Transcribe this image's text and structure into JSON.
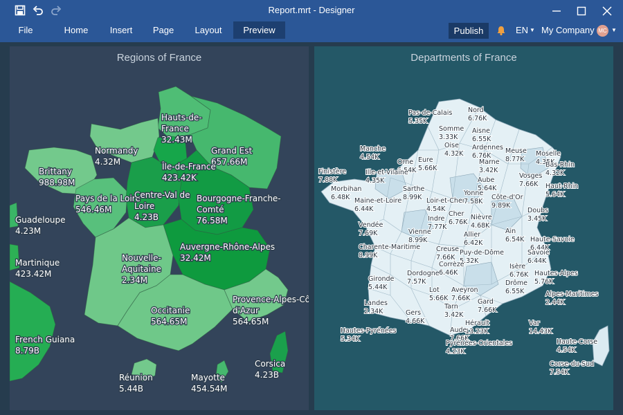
{
  "window": {
    "title": "Report.mrt - Designer",
    "save_icon": "save-icon",
    "undo_icon": "undo-icon",
    "redo_icon": "redo-icon"
  },
  "menu": {
    "file": "File",
    "home": "Home",
    "insert": "Insert",
    "page": "Page",
    "layout": "Layout",
    "preview": "Preview",
    "publish": "Publish",
    "language": "EN",
    "company": "My Company",
    "avatar_initials": "MC"
  },
  "colors": {
    "accent": "#2b5797",
    "region_fill": "#3ab566",
    "department_fill": "#e4f0f5"
  },
  "regions_map": {
    "title": "Regions of France",
    "regions": [
      {
        "name": "Hauts-de-France",
        "label": [
          "Hauts-de-",
          "France",
          "32.43M"
        ]
      },
      {
        "name": "Normandy",
        "label": [
          "Normandy",
          "4.32M"
        ]
      },
      {
        "name": "Brittany",
        "label": [
          "Brittany",
          "988.98M"
        ]
      },
      {
        "name": "Grand Est",
        "label": [
          "Grand Est",
          "657.66M"
        ]
      },
      {
        "name": "Île-de-France",
        "label": [
          "Île-de-France",
          "423.42K"
        ]
      },
      {
        "name": "Pays de la Loire",
        "label": [
          "Pays de la Loire",
          "546.46M"
        ]
      },
      {
        "name": "Centre-Val de Loire",
        "label": [
          "Centre-Val de",
          "Loire",
          "4.23B"
        ]
      },
      {
        "name": "Bourgogne-Franche-Comté",
        "label": [
          "Bourgogne-Franche-",
          "Comté",
          "76.58M"
        ]
      },
      {
        "name": "Guadeloupe",
        "label": [
          "Guadeloupe",
          "4.23M"
        ]
      },
      {
        "name": "Auvergne-Rhône-Alpes",
        "label": [
          "Auvergne-Rhône-Alpes",
          "32.42M"
        ]
      },
      {
        "name": "Martinique",
        "label": [
          "Martinique",
          "423.42M"
        ]
      },
      {
        "name": "Nouvelle-Aquitaine",
        "label": [
          "Nouvelle-",
          "Aquitaine",
          "2.34M"
        ]
      },
      {
        "name": "Provence-Alpes-Côte d'Azur",
        "label": [
          "Provence-Alpes-Cô",
          "d'Azur",
          "564.65M"
        ]
      },
      {
        "name": "Occitanie",
        "label": [
          "Occitanie",
          "564.65M"
        ]
      },
      {
        "name": "French Guiana",
        "label": [
          "French Guiana",
          "8.79B"
        ]
      },
      {
        "name": "Corsica",
        "label": [
          "Corsica",
          "4.23B"
        ]
      },
      {
        "name": "Réunion",
        "label": [
          "Réunion",
          "5.44B"
        ]
      },
      {
        "name": "Mayotte",
        "label": [
          "Mayotte",
          "454.54M"
        ]
      }
    ]
  },
  "departments_map": {
    "title": "Departments of France",
    "departments": [
      {
        "name": "Pas-de-Calais",
        "value": "5.35K"
      },
      {
        "name": "Nord",
        "value": "6.76K"
      },
      {
        "name": "Somme",
        "value": "3.33K"
      },
      {
        "name": "Aisne",
        "value": "6.55K"
      },
      {
        "name": "Oise",
        "value": "4.32K"
      },
      {
        "name": "Manche",
        "value": "4.54K"
      },
      {
        "name": "Eure",
        "value": "5.66K"
      },
      {
        "name": "Ardennes",
        "value": "6.76K"
      },
      {
        "name": "Marne",
        "value": "3.42K"
      },
      {
        "name": "Meuse",
        "value": "8.77K"
      },
      {
        "name": "Moselle",
        "value": "4.35K"
      },
      {
        "name": "Orne",
        "value": "6.54K"
      },
      {
        "name": "Finistère",
        "value": "7.88K"
      },
      {
        "name": "Ille-et-Vilaine",
        "value": "4.35K"
      },
      {
        "name": "Aube",
        "value": "5.64K"
      },
      {
        "name": "Vosges",
        "value": "7.66K"
      },
      {
        "name": "Bas-Rhin",
        "value": "4.32K"
      },
      {
        "name": "Morbihan",
        "value": "6.48K"
      },
      {
        "name": "Sarthe",
        "value": "8.99K"
      },
      {
        "name": "Haut-Rhin",
        "value": "5.64K"
      },
      {
        "name": "Maine-et-Loire",
        "value": "6.44K"
      },
      {
        "name": "Loir-et-Cher",
        "value": "4.54K"
      },
      {
        "name": "Yonne",
        "value": "7.58K"
      },
      {
        "name": "Côte-d'Or",
        "value": "9.89K"
      },
      {
        "name": "Doubs",
        "value": "3.45K"
      },
      {
        "name": "Indre",
        "value": "7.77K"
      },
      {
        "name": "Cher",
        "value": "6.76K"
      },
      {
        "name": "Nièvre",
        "value": "4.68K"
      },
      {
        "name": "Vendée",
        "value": "7.69K"
      },
      {
        "name": "Vienne",
        "value": "8.99K"
      },
      {
        "name": "Allier",
        "value": "6.42K"
      },
      {
        "name": "Ain",
        "value": "6.54K"
      },
      {
        "name": "Haute-Savoie",
        "value": "6.44K"
      },
      {
        "name": "Charente-Maritime",
        "value": "8.99K"
      },
      {
        "name": "Creuse",
        "value": "7.66K"
      },
      {
        "name": "Puy-de-Dôme",
        "value": "5.32K"
      },
      {
        "name": "Savoie",
        "value": "6.44K"
      },
      {
        "name": "Corrèze",
        "value": "6.46K"
      },
      {
        "name": "Isère",
        "value": "6.76K"
      },
      {
        "name": "Dordogne",
        "value": "7.57K"
      },
      {
        "name": "Hautes-Alpes",
        "value": "5.76K"
      },
      {
        "name": "Gironde",
        "value": "5.44K"
      },
      {
        "name": "Lot",
        "value": "5.66K"
      },
      {
        "name": "Aveyron",
        "value": "7.66K"
      },
      {
        "name": "Drôme",
        "value": "6.55K"
      },
      {
        "name": "Alpes-Maritimes",
        "value": "2.44K"
      },
      {
        "name": "Landes",
        "value": "2.34K"
      },
      {
        "name": "Tarn",
        "value": "3.42K"
      },
      {
        "name": "Gard",
        "value": "7.66K"
      },
      {
        "name": "Gers",
        "value": "4.66K"
      },
      {
        "name": "Hérault",
        "value": "13.23K"
      },
      {
        "name": "Var",
        "value": "14.43K"
      },
      {
        "name": "Aude",
        "value": "7.66K"
      },
      {
        "name": "Hautes-Pyrénées",
        "value": "5.34K"
      },
      {
        "name": "Pyrénées-Orientales",
        "value": "4.23K"
      },
      {
        "name": "Haute-Corse",
        "value": "4.54K"
      },
      {
        "name": "Corse-du-Sud",
        "value": "7.54K"
      }
    ]
  }
}
